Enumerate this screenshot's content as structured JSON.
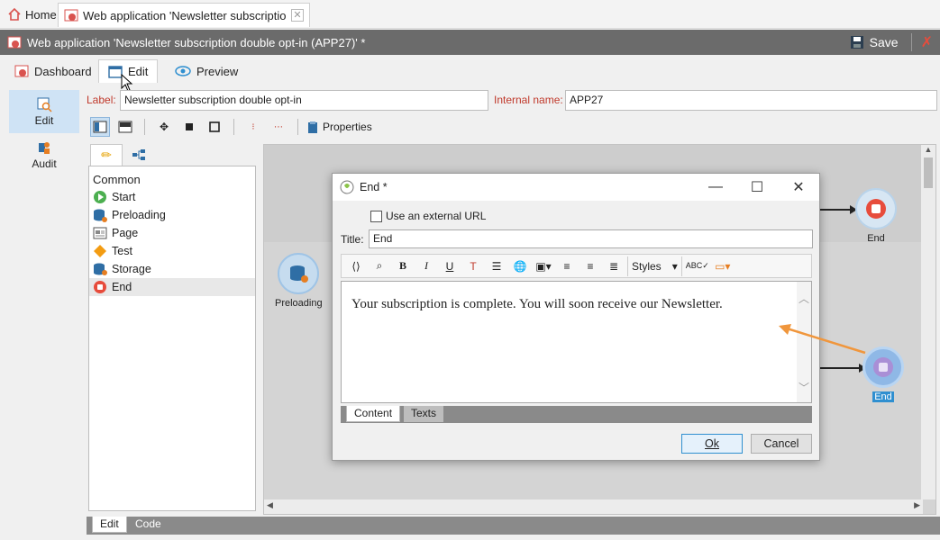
{
  "topbar": {
    "home_label": "Home",
    "doc_tab_label": "Web application 'Newsletter subscription..."
  },
  "header": {
    "title": "Web application 'Newsletter subscription double opt-in (APP27)' *",
    "save_label": "Save"
  },
  "view_tabs": [
    {
      "label": "Dashboard"
    },
    {
      "label": "Edit"
    },
    {
      "label": "Preview"
    }
  ],
  "leftnav": [
    {
      "label": "Edit"
    },
    {
      "label": "Audit"
    }
  ],
  "form": {
    "label_caption": "Label:",
    "label_value": "Newsletter subscription double opt-in",
    "internal_name_caption": "Internal name:",
    "internal_name_value": "APP27"
  },
  "toolbar": {
    "properties_label": "Properties"
  },
  "palette": {
    "category": "Common",
    "items": [
      {
        "label": "Start",
        "icon": "start-icon"
      },
      {
        "label": "Preloading",
        "icon": "database-icon"
      },
      {
        "label": "Page",
        "icon": "page-icon"
      },
      {
        "label": "Test",
        "icon": "diamond-icon"
      },
      {
        "label": "Storage",
        "icon": "storage-icon"
      },
      {
        "label": "End",
        "icon": "stop-icon"
      }
    ]
  },
  "canvas": {
    "nodes": [
      {
        "label": "Preloading"
      },
      {
        "label": "End"
      },
      {
        "label": "End"
      }
    ]
  },
  "bottom_tabs": [
    {
      "label": "Edit"
    },
    {
      "label": "Code"
    }
  ],
  "dialog": {
    "title": "End *",
    "external_url_label": "Use an external URL",
    "title_caption": "Title:",
    "title_value": "End",
    "styles_label": "Styles",
    "content_text": "Your subscription is complete. You will soon receive our Newsletter.",
    "tabs": [
      {
        "label": "Content"
      },
      {
        "label": "Texts"
      }
    ],
    "ok_label": "Ok",
    "cancel_label": "Cancel"
  },
  "colors": {
    "header_bg": "#6b6b6b",
    "label_red": "#c0392b",
    "selection_blue": "#cfe3f5",
    "node_blue": "#9fc4e6",
    "arrow_orange": "#f0963c"
  }
}
